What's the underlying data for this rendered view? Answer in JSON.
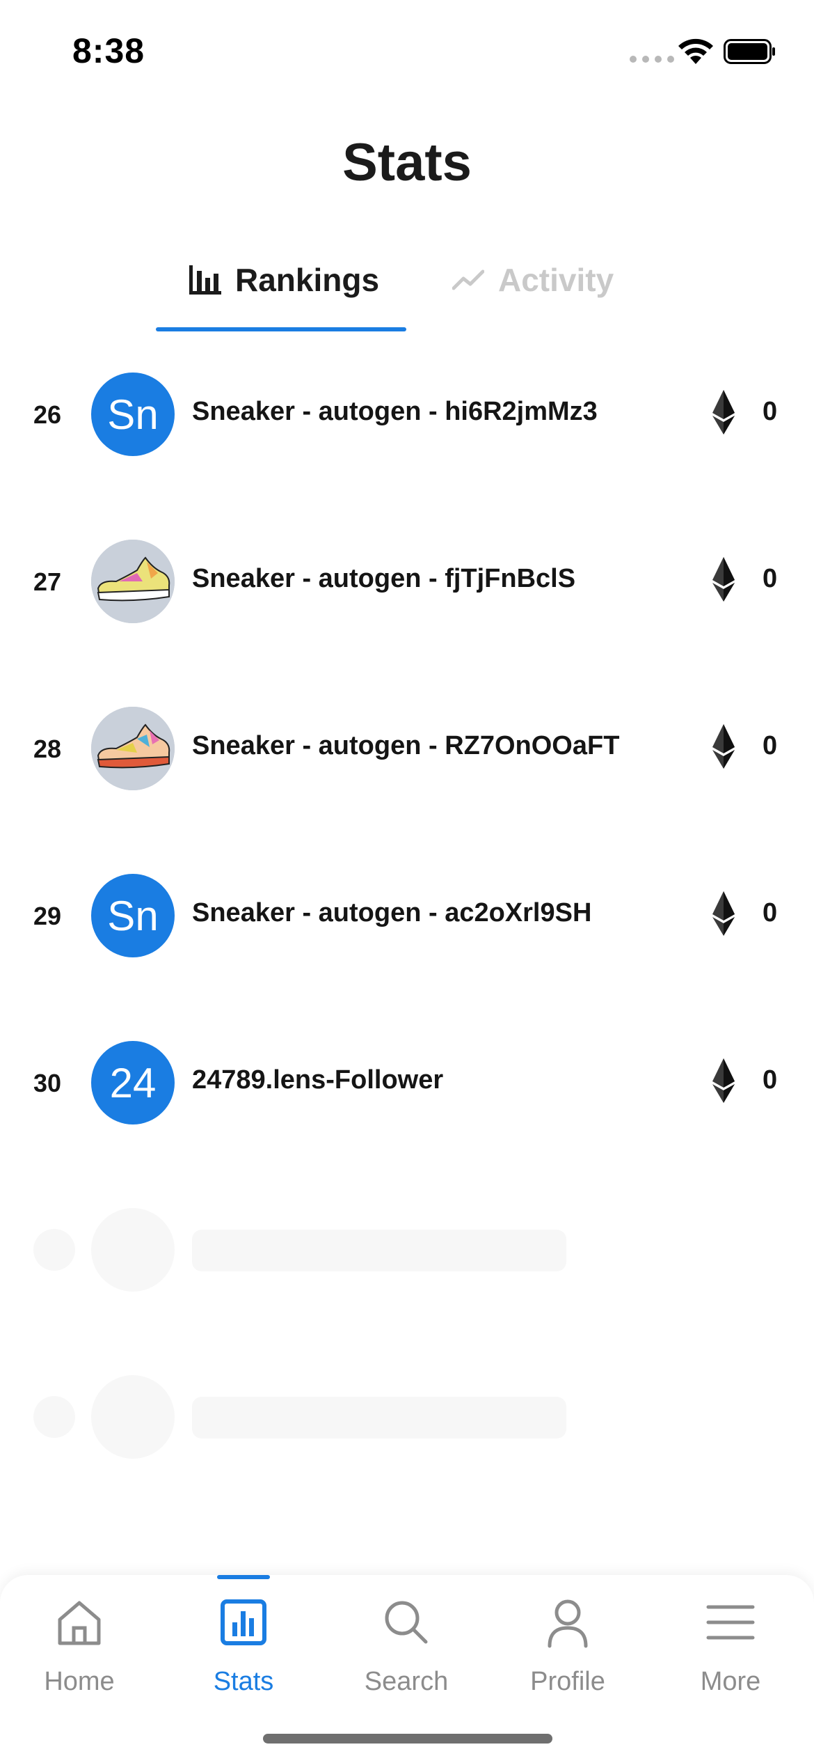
{
  "status_bar": {
    "time": "8:38"
  },
  "header": {
    "title": "Stats"
  },
  "tabs": [
    {
      "label": "Rankings",
      "icon": "bar-chart-icon",
      "active": true
    },
    {
      "label": "Activity",
      "icon": "trend-line-icon",
      "active": false
    }
  ],
  "rankings": [
    {
      "rank": "26",
      "avatar": "Sn",
      "avatar_type": "initials",
      "name": "Sneaker - autogen - hi6R2jmMz3",
      "value": "0"
    },
    {
      "rank": "27",
      "avatar_type": "sneaker-image",
      "name": "Sneaker - autogen - fjTjFnBclS",
      "value": "0"
    },
    {
      "rank": "28",
      "avatar_type": "sneaker-image",
      "name": "Sneaker - autogen - RZ7OnOOaFT",
      "value": "0"
    },
    {
      "rank": "29",
      "avatar": "Sn",
      "avatar_type": "initials",
      "name": "Sneaker - autogen - ac2oXrl9SH",
      "value": "0"
    },
    {
      "rank": "30",
      "avatar": "24",
      "avatar_type": "initials",
      "name": "24789.lens-Follower",
      "value": "0"
    }
  ],
  "bottom_nav": [
    {
      "label": "Home",
      "icon": "home-icon",
      "active": false
    },
    {
      "label": "Stats",
      "icon": "stats-icon",
      "active": true
    },
    {
      "label": "Search",
      "icon": "search-icon",
      "active": false
    },
    {
      "label": "Profile",
      "icon": "profile-icon",
      "active": false
    },
    {
      "label": "More",
      "icon": "menu-icon",
      "active": false
    }
  ],
  "colors": {
    "accent": "#1a7de2",
    "text": "#151515",
    "inactive": "#8c8c8c",
    "inactive_tab": "#c9c9c9"
  }
}
